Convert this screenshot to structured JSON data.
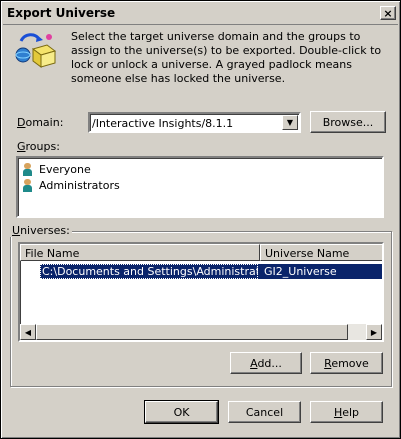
{
  "window": {
    "title": "Export Universe",
    "close_glyph": "×"
  },
  "description": "Select the target universe domain and the groups to assign to the universe(s) to be exported. Double-click to lock or unlock a universe. A grayed padlock means someone else has locked the universe.",
  "domain": {
    "label_mnemonic": "D",
    "label_rest": "omain:",
    "value": "/Interactive Insights/8.1.1",
    "browse_label": "Browse..."
  },
  "groups": {
    "label_mnemonic": "G",
    "label_rest": "roups:",
    "items": [
      {
        "label": "Everyone",
        "icon": "user-icon"
      },
      {
        "label": "Administrators",
        "icon": "user-icon"
      }
    ]
  },
  "universes": {
    "label_mnemonic": "U",
    "label_rest": "niverses:",
    "columns": [
      "File Name",
      "Universe Name"
    ],
    "rows": [
      {
        "file": "C:\\Documents and Settings\\Administrator....",
        "name": "GI2_Universe",
        "selected": true
      }
    ],
    "add_label_mnemonic": "A",
    "add_label_rest": "dd...",
    "remove_label_mnemonic": "R",
    "remove_label_rest": "emove"
  },
  "footer": {
    "ok_label": "OK",
    "cancel_label": "Cancel",
    "help_label_mnemonic": "H",
    "help_label_rest": "elp"
  },
  "colors": {
    "selection": "#0a246a",
    "face": "#d4d0c8"
  }
}
